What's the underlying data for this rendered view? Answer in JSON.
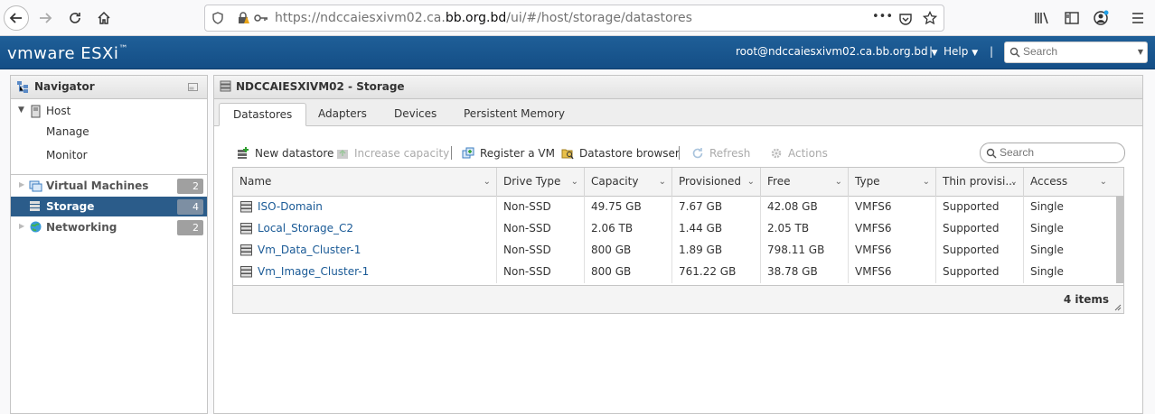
{
  "browser": {
    "url_prefix": "https://ndccaiesxivm02.ca.",
    "url_domain": "bb.org.bd",
    "url_suffix": "/ui/#/host/storage/datastores",
    "dots": "•••"
  },
  "header": {
    "logo": "vmware ESXi",
    "logo_mark": "™",
    "user": "root@ndccaiesxivm02.ca.bb.org.bd",
    "help": "Help",
    "separator": "|",
    "search_placeholder": "Search"
  },
  "navigator": {
    "title": "Navigator",
    "host": "Host",
    "host_children": [
      "Manage",
      "Monitor"
    ],
    "items": [
      {
        "label": "Virtual Machines",
        "count": "2"
      },
      {
        "label": "Storage",
        "count": "4"
      },
      {
        "label": "Networking",
        "count": "2"
      }
    ]
  },
  "main": {
    "title": "NDCCAIESXIVM02 - Storage",
    "tabs": [
      "Datastores",
      "Adapters",
      "Devices",
      "Persistent Memory"
    ],
    "toolbar": {
      "new_datastore": "New datastore",
      "increase_capacity": "Increase capacity",
      "register_vm": "Register a VM",
      "datastore_browser": "Datastore browser",
      "refresh": "Refresh",
      "actions": "Actions",
      "search_placeholder": "Search"
    },
    "columns": [
      "Name",
      "Drive Type",
      "Capacity",
      "Provisioned",
      "Free",
      "Type",
      "Thin provisi...",
      "Access"
    ],
    "rows": [
      [
        "ISO-Domain",
        "Non-SSD",
        "49.75 GB",
        "7.67 GB",
        "42.08 GB",
        "VMFS6",
        "Supported",
        "Single"
      ],
      [
        "Local_Storage_C2",
        "Non-SSD",
        "2.06 TB",
        "1.44 GB",
        "2.05 TB",
        "VMFS6",
        "Supported",
        "Single"
      ],
      [
        "Vm_Data_Cluster-1",
        "Non-SSD",
        "800 GB",
        "1.89 GB",
        "798.11 GB",
        "VMFS6",
        "Supported",
        "Single"
      ],
      [
        "Vm_Image_Cluster-1",
        "Non-SSD",
        "800 GB",
        "761.22 GB",
        "38.78 GB",
        "VMFS6",
        "Supported",
        "Single"
      ]
    ],
    "footer": "4 items"
  },
  "colors": {
    "header_bg": "#1f5f98",
    "selected_nav": "#2b5c8a",
    "link": "#1a5a96"
  }
}
